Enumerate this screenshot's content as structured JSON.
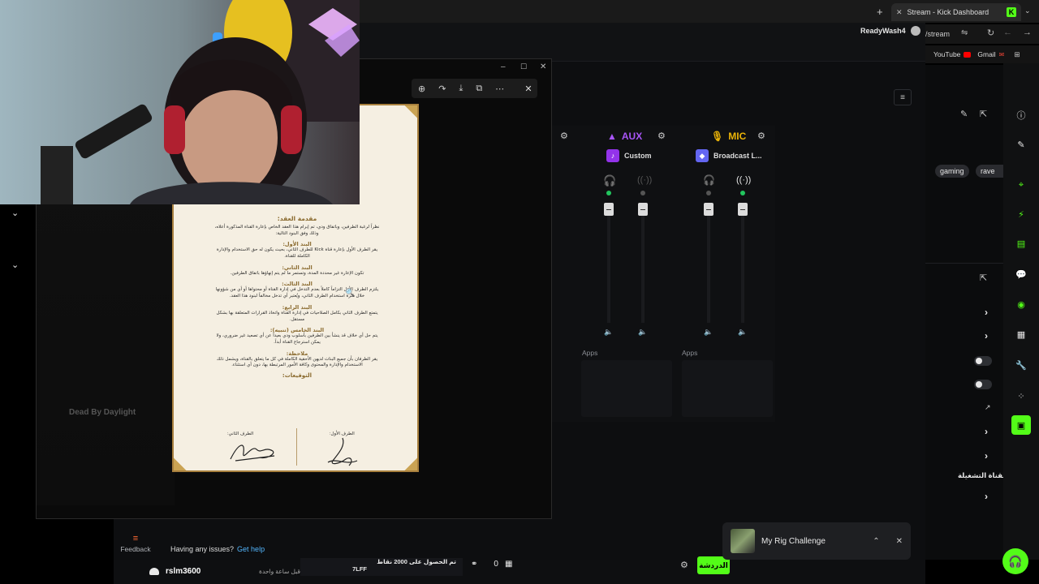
{
  "browser": {
    "tab_title": "Stream - Kick Dashboard",
    "favicon_letter": "K",
    "url_fragment": "/stream",
    "bookmarks": [
      "YouTube",
      "Gmail"
    ]
  },
  "user": {
    "name": "ReadyWash4"
  },
  "mixer": {
    "channels": [
      {
        "label": "AUX",
        "sub": "Custom",
        "color": "#a855f7"
      },
      {
        "label": "MIC",
        "sub": "Broadcast L...",
        "color": "#eab308"
      }
    ],
    "apps_label": "Apps"
  },
  "tags": [
    "gaming",
    "rave"
  ],
  "document": {
    "title": "مقدمة العقد:",
    "intro": "نظراً لرغبة الطرفين، وباتفاق ودي، تم إبرام هذا العقد الخاص بإعارة القناة المذكورة أعلاه، وذلك وفق البنود التالية:",
    "clauses": [
      {
        "heading": "البند الأول:",
        "body": "يقر الطرف الأول بإعارة قناة Kick للطرف الثاني، بحيث يكون له حق الاستخدام والإدارة الكاملة للقناة."
      },
      {
        "heading": "البند الثاني:",
        "body": "تكون الإعارة غير محددة المدة، وتستمر ما لم يتم إنهاؤها باتفاق الطرفين."
      },
      {
        "heading": "البند الثالث:",
        "body": "يلتزم الطرف الأول التزاماً كاملاً بعدم التدخل في إدارة القناة أو محتواها أو أي من شؤونها خلال فترة استخدام الطرف الثاني، ويُعتبر أي تدخل مخالفاً لبنود هذا العقد."
      },
      {
        "heading": "البند الرابع:",
        "body": "يتمتع الطرف الثاني بكامل الصلاحيات في إدارة القناة واتخاذ القرارات المتعلقة بها بشكل مستقل."
      },
      {
        "heading": "البند الخامس (تنبيه):",
        "body": "يتم حل أي خلاف قد ينشأ بين الطرفين بأسلوب ودي بعيداً عن أي تصعيد غير ضروري، ولا يمكن استرجاع القناة أبداً."
      },
      {
        "heading": "ملاحظة:",
        "body": "يقر الطرفان بأن جميع البنات لديهن الأحقية الكاملة في كل ما يتعلق بالقناة، ويشمل ذلك الاستخدام والإدارة والمحتوى وكافة الأمور المرتبطة بها، دون أي استثناء."
      }
    ],
    "signatures_title": "التوقيعات:",
    "party_two": "الطرف الثاني:",
    "party_one": "الطرف الأول:"
  },
  "left_panel": {
    "channel_name": "Dead By Daylight"
  },
  "sidebar_right": {
    "label": "القناة التشغيلة"
  },
  "bottom": {
    "chat_user": "rslm3600",
    "chat_time": "قبل ساعة واحدة",
    "ticker_text": "تم الحصول على 2000 نقاط",
    "ticker_amount": "7LFF",
    "viewer_count": "0",
    "chat_tab": "الدردشة",
    "help_text": "Having any issues?",
    "help_link": "Get help",
    "feedback": "Feedback"
  },
  "toast": {
    "title": "My Rig Challenge"
  },
  "colors": {
    "brand": "#53fc18",
    "background": "#0d0e10"
  }
}
